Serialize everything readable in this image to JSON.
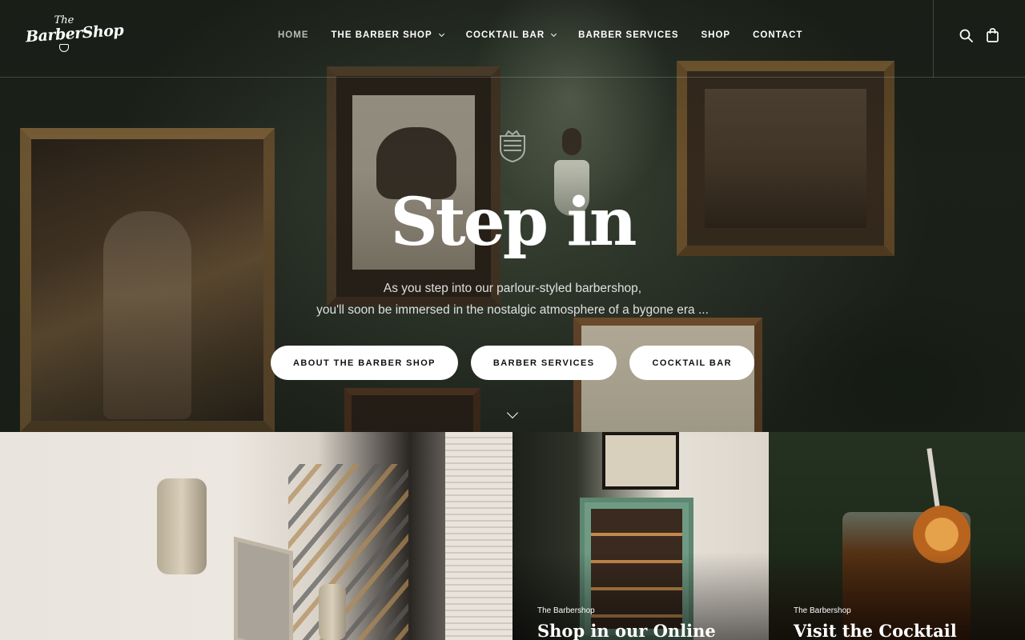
{
  "header": {
    "logo": {
      "the": "The",
      "main": "BarberShop"
    },
    "nav": [
      {
        "label": "HOME",
        "active": true,
        "dropdown": false
      },
      {
        "label": "THE BARBER SHOP",
        "active": false,
        "dropdown": true
      },
      {
        "label": "COCKTAIL BAR",
        "active": false,
        "dropdown": true
      },
      {
        "label": "BARBER SERVICES",
        "active": false,
        "dropdown": false
      },
      {
        "label": "SHOP",
        "active": false,
        "dropdown": false
      },
      {
        "label": "CONTACT",
        "active": false,
        "dropdown": false
      }
    ],
    "icons": [
      "search-icon",
      "shopping-bag-icon"
    ]
  },
  "hero": {
    "title": "Step in",
    "subtitle_line1": "As you step into our parlour-styled barbershop,",
    "subtitle_line2": "you'll soon be immersed in the nostalgic atmosphere of a bygone era ...",
    "buttons": [
      "ABOUT THE BARBER SHOP",
      "BARBER SERVICES",
      "COCKTAIL BAR"
    ],
    "scroll_icon": "chevron-down-icon"
  },
  "panels": [
    {
      "kicker": "",
      "title": ""
    },
    {
      "kicker": "The Barbershop",
      "title": "Shop in our Online"
    },
    {
      "kicker": "The Barbershop",
      "title": "Visit the Cocktail"
    }
  ],
  "colors": {
    "accent": "#ffffff",
    "nav_active": "#b9bdb2",
    "button_text": "#111111"
  }
}
